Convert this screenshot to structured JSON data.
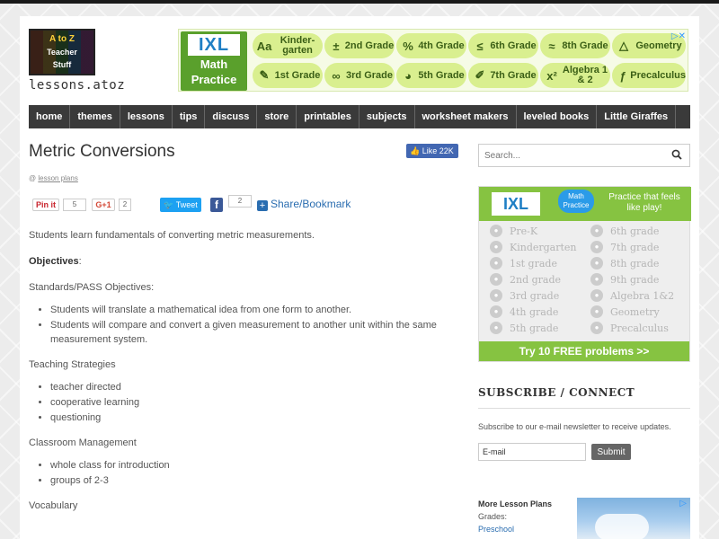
{
  "logo": {
    "line1": "A to Z",
    "line2": "Teacher",
    "line3": "Stuff",
    "text": "lessons.atoz"
  },
  "ixl_banner": {
    "brand": "IXL",
    "subtitle_1": "Math",
    "subtitle_2": "Practice",
    "close": "▷✕",
    "row1": [
      {
        "icon": "Aa",
        "label": "Kinder-garten"
      },
      {
        "icon": "±",
        "label": "2nd Grade"
      },
      {
        "icon": "%",
        "label": "4th Grade"
      },
      {
        "icon": "≤",
        "label": "6th Grade"
      },
      {
        "icon": "≈",
        "label": "8th Grade"
      },
      {
        "icon": "△",
        "label": "Geometry"
      }
    ],
    "row2": [
      {
        "icon": "✎",
        "label": "1st Grade"
      },
      {
        "icon": "∞",
        "label": "3rd Grade"
      },
      {
        "icon": "◕",
        "label": "5th Grade"
      },
      {
        "icon": "✐",
        "label": "7th Grade"
      },
      {
        "icon": "x²",
        "label": "Algebra 1 & 2"
      },
      {
        "icon": "ƒ",
        "label": "Precalculus"
      }
    ]
  },
  "nav": [
    "home",
    "themes",
    "lessons",
    "tips",
    "discuss",
    "store",
    "printables",
    "subjects",
    "worksheet makers",
    "leveled books",
    "Little Giraffes"
  ],
  "main": {
    "title": "Metric Conversions",
    "like_label": "Like 22K",
    "breadcrumb_prefix": "@",
    "breadcrumb_link": "lesson plans",
    "share": {
      "pin_label": "Pin it",
      "pin_count": "5",
      "gplus_label": "G+1",
      "gplus_count": "2",
      "tweet_label": "Tweet",
      "fb_count": "2",
      "share_label": "Share/Bookmark"
    },
    "intro": "Students learn fundamentals of converting metric measurements.",
    "objectives_label": "Objectives",
    "standards_label": "Standards/PASS Objectives:",
    "standards_items": [
      "Students will translate a mathematical idea from one form to another.",
      "Students will compare and convert a given measurement to another unit within the same measurement system."
    ],
    "strategies_label": "Teaching Strategies",
    "strategies_items": [
      "teacher directed",
      "cooperative learning",
      "questioning"
    ],
    "management_label": "Classroom Management",
    "management_items": [
      "whole class for introduction",
      "groups of 2-3"
    ],
    "vocabulary_label": "Vocabulary"
  },
  "sidebar": {
    "search_placeholder": "Search...",
    "ixl": {
      "brand": "IXL",
      "badge": "Math Practice",
      "tagline": "Practice that feels like play!",
      "grades_left": [
        "Pre-K",
        "Kindergarten",
        "1st grade",
        "2nd grade",
        "3rd grade",
        "4th grade",
        "5th grade"
      ],
      "grades_right": [
        "6th grade",
        "7th grade",
        "8th grade",
        "9th grade",
        "Algebra 1&2",
        "Geometry",
        "Precalculus"
      ],
      "cta": "Try 10 FREE problems >>"
    },
    "subscribe_title": "SUBSCRIBE / CONNECT",
    "subscribe_desc": "Subscribe to our e-mail newsletter to receive updates.",
    "email_value": "E-mail",
    "submit_label": "Submit",
    "more_title": "More Lesson Plans",
    "more_grades": "Grades:",
    "more_preschool": "Preschool"
  },
  "colors": {
    "ixl_green": "#86c341",
    "nav_bg": "#3a3a3a",
    "link_blue": "#2a6db0"
  }
}
